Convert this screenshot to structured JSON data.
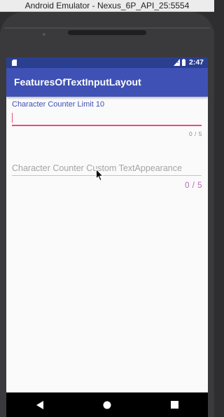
{
  "window": {
    "title": "Android Emulator - Nexus_6P_API_25:5554"
  },
  "statusbar": {
    "time": "2:47",
    "icons": [
      "sd-card-icon",
      "network-icon",
      "battery-icon"
    ]
  },
  "appbar": {
    "title": "FeaturesOfTextInputLayout"
  },
  "fields": [
    {
      "label": "Character Counter Limit 10",
      "value": "",
      "counter": "0 / 5",
      "focused": true
    },
    {
      "placeholder": "Character Counter Custom TextAppearance",
      "value": "",
      "counter": "0 / 5",
      "focused": false
    }
  ],
  "navbar": {
    "buttons": [
      "back-icon",
      "home-icon",
      "recents-icon"
    ]
  },
  "colors": {
    "primary": "#3f51b5",
    "primary_dark": "#2b3f91",
    "accent": "#ec4c7e",
    "custom_counter": "#b46ab8"
  }
}
